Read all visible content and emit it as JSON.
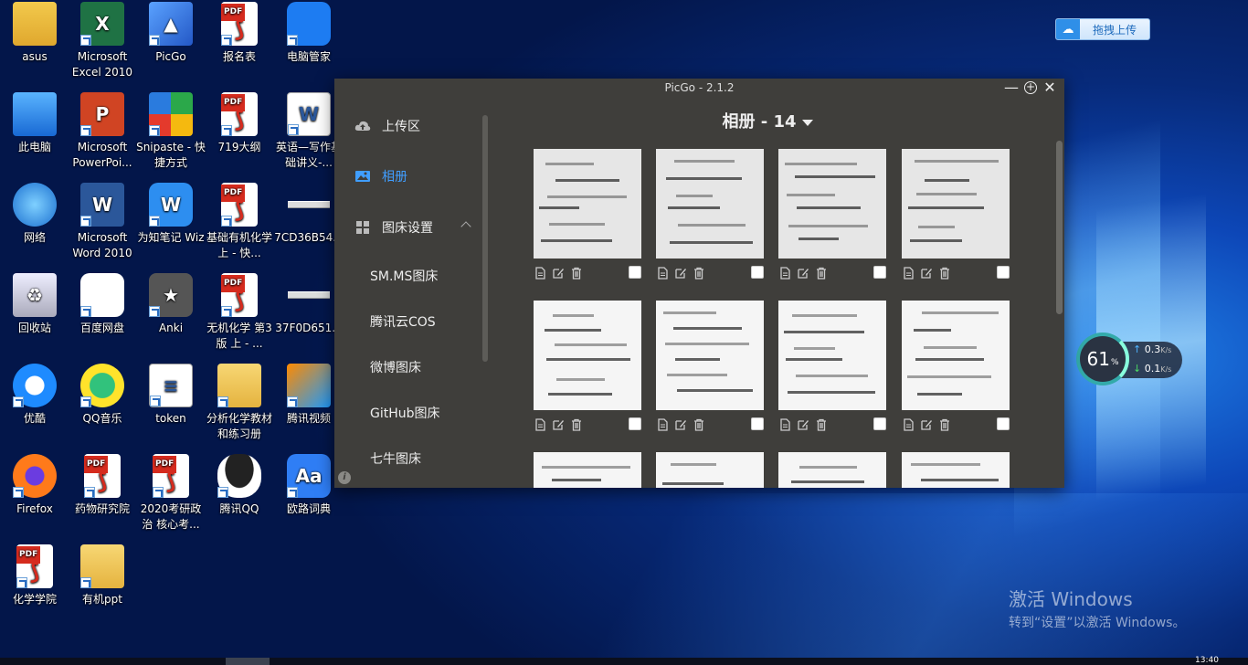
{
  "desktop": {
    "icons": [
      {
        "label": "asus",
        "icon": "user-folder-icon"
      },
      {
        "label": "Microsoft Excel 2010",
        "icon": "excel-icon"
      },
      {
        "label": "PicGo",
        "icon": "picgo-icon"
      },
      {
        "label": "报名表",
        "icon": "pdf-icon"
      },
      {
        "label": "电脑管家",
        "icon": "pc-manager-icon"
      },
      {
        "label": "此电脑",
        "icon": "this-pc-icon"
      },
      {
        "label": "Microsoft PowerPoi...",
        "icon": "powerpoint-icon"
      },
      {
        "label": "Snipaste - 快捷方式",
        "icon": "snipaste-icon"
      },
      {
        "label": "719大纲",
        "icon": "pdf-icon"
      },
      {
        "label": "英语—写作基础讲义-...",
        "icon": "word-doc-icon"
      },
      {
        "label": "网络",
        "icon": "network-icon"
      },
      {
        "label": "Microsoft Word 2010",
        "icon": "word-icon"
      },
      {
        "label": "为知笔记 Wiz",
        "icon": "wiz-icon"
      },
      {
        "label": "基础有机化学 上 - 快...",
        "icon": "pdf-icon"
      },
      {
        "label": "7CD36B54...",
        "icon": "image-file-icon"
      },
      {
        "label": "回收站",
        "icon": "recycle-bin-icon"
      },
      {
        "label": "百度网盘",
        "icon": "baidu-netdisk-icon"
      },
      {
        "label": "Anki",
        "icon": "anki-icon"
      },
      {
        "label": "无机化学 第3版 上 - ...",
        "icon": "pdf-icon"
      },
      {
        "label": "37F0D651...",
        "icon": "image-file-icon"
      },
      {
        "label": "优酷",
        "icon": "youku-icon"
      },
      {
        "label": "QQ音乐",
        "icon": "qq-music-icon"
      },
      {
        "label": "token",
        "icon": "text-file-icon"
      },
      {
        "label": "分析化学教材和练习册",
        "icon": "folder-icon"
      },
      {
        "label": "腾讯视频",
        "icon": "tencent-video-icon"
      },
      {
        "label": "Firefox",
        "icon": "firefox-icon"
      },
      {
        "label": "药物研究院",
        "icon": "pdf-icon"
      },
      {
        "label": "2020考研政治 核心考...",
        "icon": "pdf-icon"
      },
      {
        "label": "腾讯QQ",
        "icon": "qq-icon"
      },
      {
        "label": "欧路词典",
        "icon": "eudic-icon"
      },
      {
        "label": "化学学院",
        "icon": "pdf-icon"
      },
      {
        "label": "有机ppt",
        "icon": "folder-icon"
      }
    ]
  },
  "drag_upload": {
    "label": "拖拽上传"
  },
  "net_widget": {
    "percent": "61",
    "percent_unit": "%",
    "up": "0.3",
    "down": "0.1",
    "unit": "K/s"
  },
  "activation": {
    "line1": "激活 Windows",
    "line2": "转到“设置”以激活 Windows。"
  },
  "taskbar": {
    "clock": "13:40"
  },
  "picgo": {
    "title": "PicGo - 2.1.2",
    "window_buttons": {
      "minimize": "—",
      "pin": "+",
      "close": "✕"
    },
    "sidebar": {
      "upload": "上传区",
      "album": "相册",
      "pic_settings": "图床设置",
      "beds": [
        "SM.MS图床",
        "腾讯云COS",
        "微博图床",
        "GitHub图床",
        "七牛图床"
      ]
    },
    "album_title": "相册 - 14",
    "colors": {
      "accent": "#409eff",
      "window_bg": "#3f3e3b"
    }
  }
}
